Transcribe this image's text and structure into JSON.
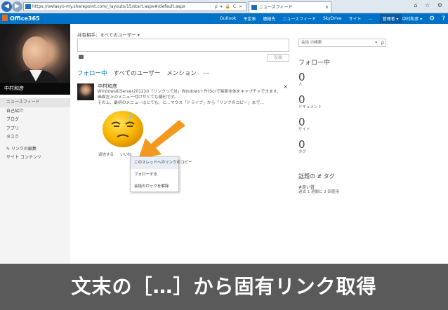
{
  "browser": {
    "back_icon": "back-arrow-icon",
    "forward_icon": "forward-arrow-icon",
    "url": "https://owlasyo-my.sharepoint.com/_layouts/15/start.aspx#/default.aspx",
    "address_tools": "ρ ▾ 🔒 C ×",
    "tab_title": "ニュースフィード",
    "tab_close": "×",
    "window_icons": "⌂ ☆ ⚙"
  },
  "suite": {
    "brand": "Office365",
    "nav": [
      "Outlook",
      "予定表",
      "連絡先",
      "ニュースフィード",
      "SkyDrive",
      "サイト",
      "…",
      "管理者 ▾"
    ],
    "user": "中村和彦 ▾",
    "settings_icon": "⚙",
    "help_icon": "?"
  },
  "profile": {
    "name": "中村和彦"
  },
  "leftnav": {
    "items": [
      "ニュースフィード",
      "自己紹介",
      "ブログ",
      "アプリ",
      "タスク"
    ],
    "items2": [
      "✎ リンクの編集",
      "サイト コンテンツ"
    ]
  },
  "share": {
    "label": "共有相手：すべてのユーザー ▾",
    "post_button": "投稿"
  },
  "tabs": [
    "フォロー中",
    "すべてのユーザー",
    "メンション",
    "…"
  ],
  "feed_item": {
    "author": "中村和彦",
    "line1": "Windows8[Server2012]の「リンクって対」Windows＋PrtScrで画面全体をキャプチャできます。",
    "line2": "画面左上のメニュー付けがとても便利です。",
    "line3": "その上、最初のメニューはとても、と…マウス「ドライブ」から「リンクのコピー」まで…",
    "close": "×",
    "actions": [
      "返信する",
      "いいね",
      "…"
    ]
  },
  "context_menu": {
    "items": [
      "このスレッドへのリンクのコピー",
      "フォローする",
      "会話のロックを解除"
    ]
  },
  "right": {
    "search_placeholder": "会話 の検索",
    "search_dropdown": "▾",
    "search_icon": "ρ",
    "follow_title": "フォロー中",
    "stats": [
      {
        "value": "0",
        "label": "人"
      },
      {
        "value": "0",
        "label": "ドキュメント"
      },
      {
        "value": "0",
        "label": "サイト"
      },
      {
        "value": "0",
        "label": "タグ"
      }
    ],
    "trend_title": "話題の # タグ",
    "trend_tag": "#良い質",
    "trend_sub": "過去 1 週間に 2 回使用"
  },
  "banner": {
    "text": "文末の［…］から固有リンク取得"
  },
  "colors": {
    "suite_bar": "#0072c6",
    "accent": "#0072c6",
    "arrow": "#f39a1e",
    "banner": "#4e4e4e"
  }
}
